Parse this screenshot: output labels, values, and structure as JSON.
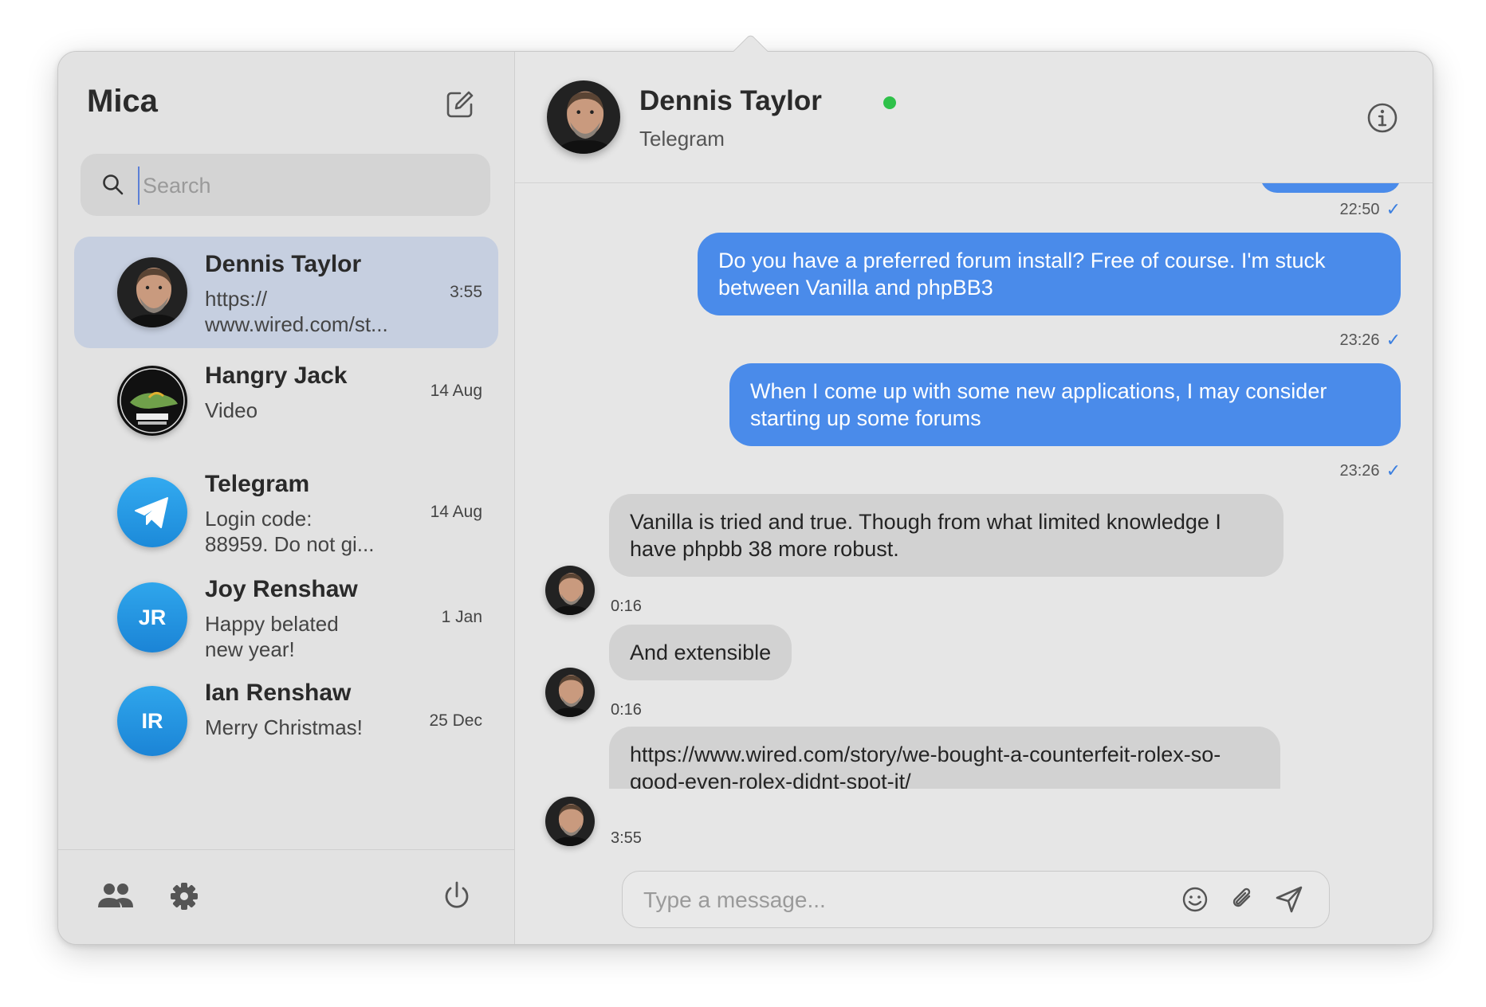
{
  "app": {
    "title": "Mica"
  },
  "search": {
    "placeholder": "Search"
  },
  "chats": [
    {
      "name": "Dennis Taylor",
      "preview": "https://\nwww.wired.com/st...",
      "time": "3:55",
      "avatar": "photo-dennis",
      "selected": true
    },
    {
      "name": "Hangry Jack",
      "preview": "Video",
      "time": "14 Aug",
      "avatar": "photo-jerky-logo"
    },
    {
      "name": "Telegram",
      "preview": "Login code:\n88959. Do not gi...",
      "time": "14 Aug",
      "avatar": "telegram-logo"
    },
    {
      "name": "Joy Renshaw",
      "preview": "Happy belated\nnew year!",
      "time": "1 Jan",
      "avatar": "JR"
    },
    {
      "name": "Ian Renshaw",
      "preview": "Merry Christmas!",
      "time": "25 Dec",
      "avatar": "IR"
    }
  ],
  "header": {
    "name": "Dennis Taylor",
    "subtitle": "Telegram",
    "status": "online"
  },
  "messages": [
    {
      "dir": "out",
      "text": "",
      "time": "22:50",
      "read": true
    },
    {
      "dir": "out",
      "text": "Do you have a preferred forum install? Free of course. I'm stuck between Vanilla and phpBB3",
      "time": "23:26",
      "read": true
    },
    {
      "dir": "out",
      "text": "When I come up with some new applications, I may consider starting up some forums",
      "time": "23:26",
      "read": true
    },
    {
      "dir": "in",
      "text": "Vanilla is tried and true. Though from what limited knowledge I have phpbb 38 more robust.",
      "time": "0:16"
    },
    {
      "dir": "in",
      "text": "And extensible",
      "time": "0:16"
    },
    {
      "dir": "in",
      "text": "https://www.wired.com/story/we-bought-a-counterfeit-rolex-so-good-even-rolex-didnt-spot-it/",
      "time": "3:55"
    }
  ],
  "composer": {
    "placeholder": "Type a message..."
  },
  "check_glyph": "✓",
  "colors": {
    "accent": "#4a8bea",
    "online": "#2fc14a",
    "selected_row": "#c6cfe0"
  }
}
